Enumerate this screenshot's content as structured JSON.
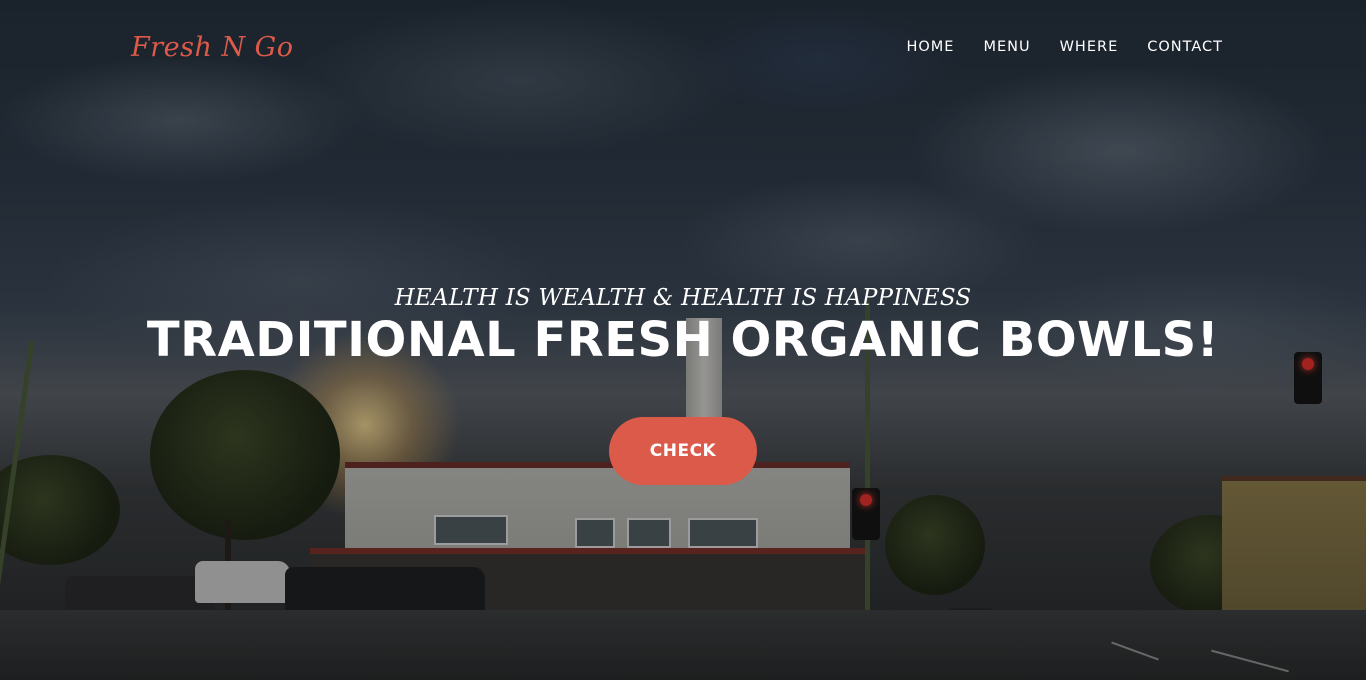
{
  "brand": {
    "logo_text": "Fresh N Go",
    "accent_color": "#dc5a49"
  },
  "nav": {
    "items": [
      {
        "label": "HOME"
      },
      {
        "label": "MENU"
      },
      {
        "label": "WHERE"
      },
      {
        "label": "CONTACT"
      }
    ]
  },
  "hero": {
    "subheading": "HEALTH IS WEALTH & HEALTH IS HAPPINESS",
    "heading": "TRADITIONAL FRESH ORGANIC BOWLS!",
    "cta_label": "CHECK",
    "background": "street-scene-photo"
  }
}
